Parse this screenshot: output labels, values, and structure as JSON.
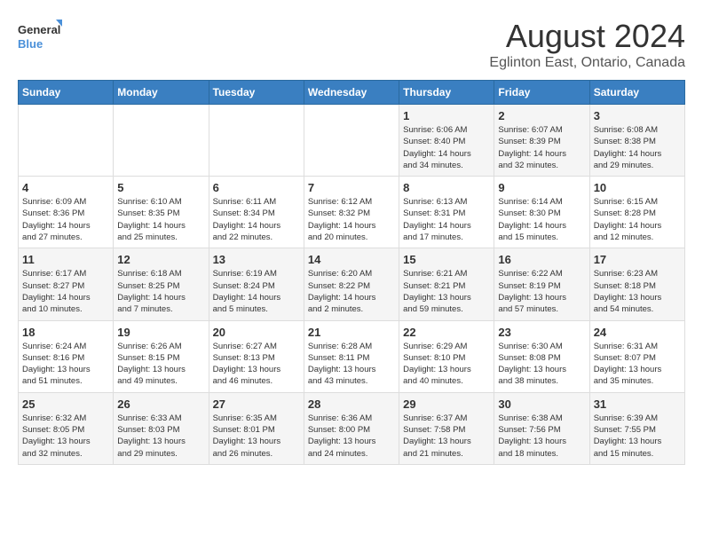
{
  "logo": {
    "line1": "General",
    "line2": "Blue"
  },
  "title": "August 2024",
  "subtitle": "Eglinton East, Ontario, Canada",
  "days_of_week": [
    "Sunday",
    "Monday",
    "Tuesday",
    "Wednesday",
    "Thursday",
    "Friday",
    "Saturday"
  ],
  "weeks": [
    [
      {
        "day": "",
        "info": ""
      },
      {
        "day": "",
        "info": ""
      },
      {
        "day": "",
        "info": ""
      },
      {
        "day": "",
        "info": ""
      },
      {
        "day": "1",
        "info": "Sunrise: 6:06 AM\nSunset: 8:40 PM\nDaylight: 14 hours\nand 34 minutes."
      },
      {
        "day": "2",
        "info": "Sunrise: 6:07 AM\nSunset: 8:39 PM\nDaylight: 14 hours\nand 32 minutes."
      },
      {
        "day": "3",
        "info": "Sunrise: 6:08 AM\nSunset: 8:38 PM\nDaylight: 14 hours\nand 29 minutes."
      }
    ],
    [
      {
        "day": "4",
        "info": "Sunrise: 6:09 AM\nSunset: 8:36 PM\nDaylight: 14 hours\nand 27 minutes."
      },
      {
        "day": "5",
        "info": "Sunrise: 6:10 AM\nSunset: 8:35 PM\nDaylight: 14 hours\nand 25 minutes."
      },
      {
        "day": "6",
        "info": "Sunrise: 6:11 AM\nSunset: 8:34 PM\nDaylight: 14 hours\nand 22 minutes."
      },
      {
        "day": "7",
        "info": "Sunrise: 6:12 AM\nSunset: 8:32 PM\nDaylight: 14 hours\nand 20 minutes."
      },
      {
        "day": "8",
        "info": "Sunrise: 6:13 AM\nSunset: 8:31 PM\nDaylight: 14 hours\nand 17 minutes."
      },
      {
        "day": "9",
        "info": "Sunrise: 6:14 AM\nSunset: 8:30 PM\nDaylight: 14 hours\nand 15 minutes."
      },
      {
        "day": "10",
        "info": "Sunrise: 6:15 AM\nSunset: 8:28 PM\nDaylight: 14 hours\nand 12 minutes."
      }
    ],
    [
      {
        "day": "11",
        "info": "Sunrise: 6:17 AM\nSunset: 8:27 PM\nDaylight: 14 hours\nand 10 minutes."
      },
      {
        "day": "12",
        "info": "Sunrise: 6:18 AM\nSunset: 8:25 PM\nDaylight: 14 hours\nand 7 minutes."
      },
      {
        "day": "13",
        "info": "Sunrise: 6:19 AM\nSunset: 8:24 PM\nDaylight: 14 hours\nand 5 minutes."
      },
      {
        "day": "14",
        "info": "Sunrise: 6:20 AM\nSunset: 8:22 PM\nDaylight: 14 hours\nand 2 minutes."
      },
      {
        "day": "15",
        "info": "Sunrise: 6:21 AM\nSunset: 8:21 PM\nDaylight: 13 hours\nand 59 minutes."
      },
      {
        "day": "16",
        "info": "Sunrise: 6:22 AM\nSunset: 8:19 PM\nDaylight: 13 hours\nand 57 minutes."
      },
      {
        "day": "17",
        "info": "Sunrise: 6:23 AM\nSunset: 8:18 PM\nDaylight: 13 hours\nand 54 minutes."
      }
    ],
    [
      {
        "day": "18",
        "info": "Sunrise: 6:24 AM\nSunset: 8:16 PM\nDaylight: 13 hours\nand 51 minutes."
      },
      {
        "day": "19",
        "info": "Sunrise: 6:26 AM\nSunset: 8:15 PM\nDaylight: 13 hours\nand 49 minutes."
      },
      {
        "day": "20",
        "info": "Sunrise: 6:27 AM\nSunset: 8:13 PM\nDaylight: 13 hours\nand 46 minutes."
      },
      {
        "day": "21",
        "info": "Sunrise: 6:28 AM\nSunset: 8:11 PM\nDaylight: 13 hours\nand 43 minutes."
      },
      {
        "day": "22",
        "info": "Sunrise: 6:29 AM\nSunset: 8:10 PM\nDaylight: 13 hours\nand 40 minutes."
      },
      {
        "day": "23",
        "info": "Sunrise: 6:30 AM\nSunset: 8:08 PM\nDaylight: 13 hours\nand 38 minutes."
      },
      {
        "day": "24",
        "info": "Sunrise: 6:31 AM\nSunset: 8:07 PM\nDaylight: 13 hours\nand 35 minutes."
      }
    ],
    [
      {
        "day": "25",
        "info": "Sunrise: 6:32 AM\nSunset: 8:05 PM\nDaylight: 13 hours\nand 32 minutes."
      },
      {
        "day": "26",
        "info": "Sunrise: 6:33 AM\nSunset: 8:03 PM\nDaylight: 13 hours\nand 29 minutes."
      },
      {
        "day": "27",
        "info": "Sunrise: 6:35 AM\nSunset: 8:01 PM\nDaylight: 13 hours\nand 26 minutes."
      },
      {
        "day": "28",
        "info": "Sunrise: 6:36 AM\nSunset: 8:00 PM\nDaylight: 13 hours\nand 24 minutes."
      },
      {
        "day": "29",
        "info": "Sunrise: 6:37 AM\nSunset: 7:58 PM\nDaylight: 13 hours\nand 21 minutes."
      },
      {
        "day": "30",
        "info": "Sunrise: 6:38 AM\nSunset: 7:56 PM\nDaylight: 13 hours\nand 18 minutes."
      },
      {
        "day": "31",
        "info": "Sunrise: 6:39 AM\nSunset: 7:55 PM\nDaylight: 13 hours\nand 15 minutes."
      }
    ]
  ]
}
